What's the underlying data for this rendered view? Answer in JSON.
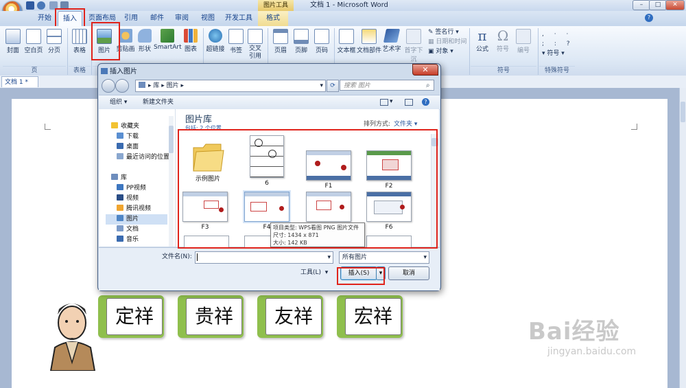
{
  "window": {
    "title": "文档 1 - Microsoft Word",
    "context_tab_title": "图片工具",
    "min": "–",
    "max": "□",
    "close": "✕",
    "help": "?"
  },
  "tabs": [
    "开始",
    "插入",
    "页面布局",
    "引用",
    "邮件",
    "审阅",
    "视图",
    "开发工具",
    "格式"
  ],
  "ribbon": {
    "groups": [
      "页",
      "表格",
      "插图",
      "符号",
      "特殊符号"
    ],
    "buttons": {
      "cover": "封面",
      "blank": "空白页",
      "pagebreak": "分页",
      "table": "表格",
      "picture": "图片",
      "clipart": "剪贴画",
      "shapes": "形状",
      "smartart": "SmartArt",
      "chart": "图表",
      "hyperlink": "超链接",
      "bookmark": "书签",
      "crossref": "交叉引用",
      "header": "页眉",
      "footer": "页脚",
      "pagenum": "页码",
      "textbox": "文本框",
      "quickparts": "文档部件",
      "wordart": "艺术字",
      "dropcap": "首字下沉",
      "signature": "签名行",
      "datetime": "日期和时间",
      "object": "对象",
      "equation": "公式",
      "symbol": "符号",
      "number": "编号",
      "special_symbol": "符号"
    }
  },
  "doc_tab": "文档 1 *",
  "dialog": {
    "title": "插入图片",
    "breadcrumb": [
      "库",
      "图片"
    ],
    "search_placeholder": "搜索 图片",
    "organize": "组织",
    "new_folder": "新建文件夹",
    "nav": {
      "favorites": "收藏夹",
      "favorites_items": [
        "下载",
        "桌面",
        "最近访问的位置"
      ],
      "libraries": "库",
      "library_items": [
        "PP视频",
        "视频",
        "腾讯视频",
        "图片",
        "文档",
        "音乐"
      ]
    },
    "library_title": "图片库",
    "library_subtitle": "包括: 2 个位置",
    "arrange_by_label": "排列方式:",
    "arrange_by_value": "文件夹",
    "items": [
      "示例图片",
      "6",
      "F1",
      "F2",
      "F3",
      "F4",
      "F5",
      "F6"
    ],
    "tooltip": {
      "type": "项目类型: WPS看图 PNG 图片文件",
      "size": "尺寸: 1434 x 871",
      "filesize": "大小: 142 KB"
    },
    "filename_label": "文件名(N):",
    "filename_value": "",
    "filetype_value": "所有图片",
    "tools": "工具(L)",
    "insert": "插入(S)",
    "cancel": "取消"
  },
  "doc_boxes": [
    "定祥",
    "贵祥",
    "友祥",
    "宏祥"
  ],
  "watermark": {
    "brand": "Bai经验",
    "url": "jingyan.baidu.com"
  },
  "colors": {
    "highlight": "#e0231b",
    "box_green": "#8fbf4d",
    "ribbon_blue": "#15428b"
  }
}
